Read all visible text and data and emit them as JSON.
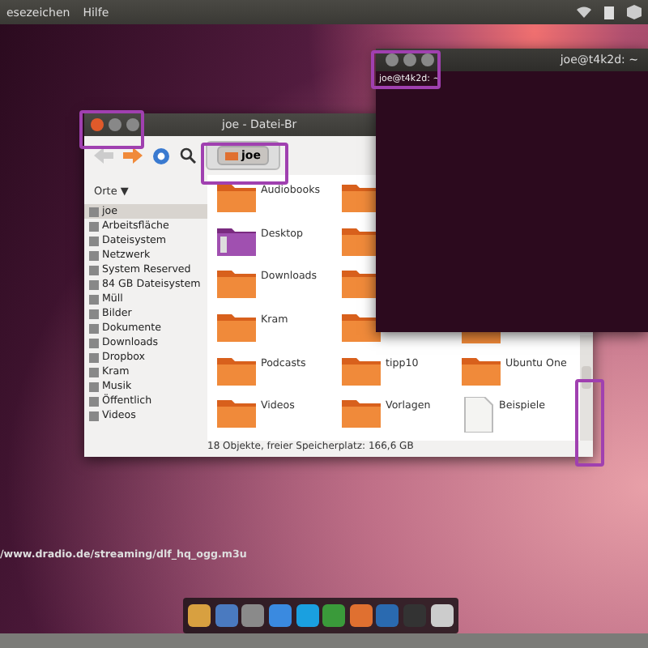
{
  "top_panel": {
    "menus": [
      "esezeichen",
      "Hilfe"
    ]
  },
  "terminal": {
    "title": "joe@t4k2d: ~",
    "tab": "joe@t4k2d: ~"
  },
  "file_manager": {
    "title": "joe - Datei-Br",
    "path": [
      "joe"
    ],
    "sidebar": {
      "header": "Orte ▼",
      "items": [
        {
          "label": "joe",
          "selected": true
        },
        {
          "label": "Arbeitsfläche",
          "selected": false
        },
        {
          "label": "Dateisystem",
          "selected": false
        },
        {
          "label": "Netzwerk",
          "selected": false
        },
        {
          "label": "System Reserved",
          "selected": false
        },
        {
          "label": "84 GB Dateisystem",
          "selected": false
        },
        {
          "label": "Müll",
          "selected": false
        },
        {
          "label": "Bilder",
          "selected": false
        },
        {
          "label": "Dokumente",
          "selected": false
        },
        {
          "label": "Downloads",
          "selected": false
        },
        {
          "label": "Dropbox",
          "selected": false
        },
        {
          "label": "Kram",
          "selected": false
        },
        {
          "label": "Musik",
          "selected": false
        },
        {
          "label": "Öffentlich",
          "selected": false
        },
        {
          "label": "Videos",
          "selected": false
        }
      ]
    },
    "file_rows": [
      [
        {
          "kind": "folder",
          "label": "Audiobooks"
        },
        {
          "kind": "folder"
        }
      ],
      [
        {
          "kind": "desktop",
          "label": "Desktop"
        },
        {
          "kind": "folder"
        }
      ],
      [
        {
          "kind": "folder",
          "label": "Downloads"
        },
        {
          "kind": "folder"
        }
      ],
      [
        {
          "kind": "folder",
          "label": "Kram"
        },
        {
          "kind": "folder"
        },
        {
          "kind": "folder_cut"
        }
      ],
      [
        {
          "kind": "folder",
          "label": "Podcasts"
        },
        {
          "kind": "folder",
          "label": "tipp10"
        },
        {
          "kind": "folder",
          "label": "Ubuntu One"
        }
      ],
      [
        {
          "kind": "folder",
          "label": "Videos"
        },
        {
          "kind": "folder",
          "label": "Vorlagen"
        },
        {
          "kind": "document",
          "label": "Beispiele"
        }
      ]
    ],
    "status": "18 Objekte, freier Speicherplatz: 166,6 GB"
  },
  "desktop_text": {
    "line": "/www.dradio.de/streaming/dlf_hq_ogg.m3u"
  }
}
